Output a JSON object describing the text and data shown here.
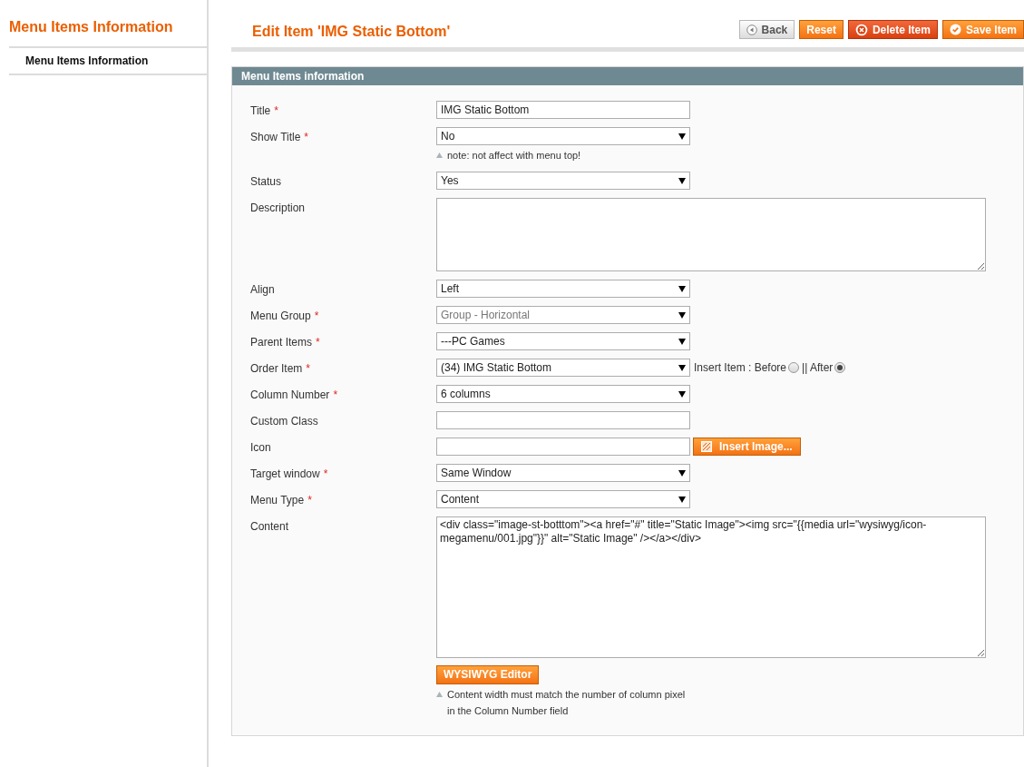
{
  "sidebar": {
    "title": "Menu Items Information",
    "items": [
      {
        "label": "Menu Items Information",
        "selected": true
      }
    ]
  },
  "header": {
    "title": "Edit Item 'IMG Static Bottom'",
    "buttons": [
      {
        "label": "Back",
        "kind": "back"
      },
      {
        "label": "Reset",
        "kind": "reset"
      },
      {
        "label": "Delete Item",
        "kind": "delete"
      },
      {
        "label": "Save Item",
        "kind": "save"
      }
    ]
  },
  "section": {
    "title": "Menu Items information",
    "fields": [
      {
        "kind": "text",
        "label": "Title",
        "mark": "*",
        "value": "IMG Static Bottom"
      },
      {
        "kind": "select",
        "label": "Show Title",
        "mark": "*",
        "value": "No",
        "disabled": false,
        "notes": [
          "note: not affect with menu top!"
        ]
      },
      {
        "kind": "select",
        "label": "Status",
        "value": "Yes",
        "disabled": false
      },
      {
        "kind": "textarea",
        "label": "Description"
      },
      {
        "kind": "select",
        "label": "Align",
        "value": "Left",
        "disabled": false
      },
      {
        "kind": "select",
        "label": "Menu Group",
        "mark": "*",
        "value": "Group - Horizontal",
        "disabled": true
      },
      {
        "kind": "select",
        "label": "Parent Items",
        "mark": "*",
        "value": "---PC Games",
        "disabled": false
      },
      {
        "kind": "select",
        "label": "Order Item",
        "mark": "*",
        "value": "(34) IMG Static Bottom",
        "disabled": false,
        "options": [
          {
            "label": "Insert Item : Before",
            "selected": false
          },
          {
            "label": "|| After",
            "selected": true
          }
        ]
      },
      {
        "kind": "select",
        "label": "Column Number",
        "mark": "*",
        "value": "6 columns",
        "disabled": false
      },
      {
        "kind": "text",
        "label": "Custom Class"
      },
      {
        "kind": "text",
        "label": "Icon",
        "button": "Insert Image..."
      },
      {
        "kind": "select",
        "label": "Target window",
        "mark": "*",
        "value": "Same Window",
        "disabled": false
      },
      {
        "kind": "select",
        "label": "Menu Type",
        "mark": "*",
        "value": "Content",
        "disabled": false
      },
      {
        "kind": "textarea",
        "label": "Content",
        "value": "<div class=\"image-st-botttom\"><a href=\"#\" title=\"Static Image\"><img src=\"{{media url=\"wysiwyg/icon-megamenu/001.jpg\"}}\" alt=\"Static Image\" /></a></div>",
        "button": "WYSIWYG Editor",
        "notes": [
          "Content width must match the number of column pixel",
          "in the Column Number field"
        ]
      }
    ]
  }
}
